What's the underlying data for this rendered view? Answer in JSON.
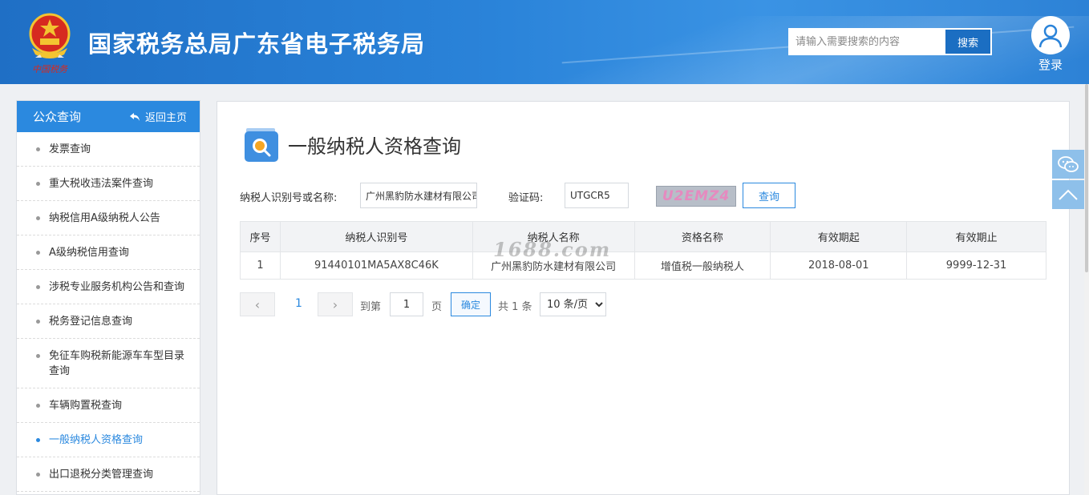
{
  "header": {
    "emblem_text": "中国税务",
    "site_title": "国家税务总局广东省电子税务局",
    "search_placeholder": "请输入需要搜索的内容",
    "search_button": "搜索",
    "login_label": "登录"
  },
  "sidebar": {
    "title": "公众查询",
    "back_home": "返回主页",
    "items": [
      {
        "label": "发票查询"
      },
      {
        "label": "重大税收违法案件查询"
      },
      {
        "label": "纳税信用A级纳税人公告"
      },
      {
        "label": "A级纳税信用查询"
      },
      {
        "label": "涉税专业服务机构公告和查询"
      },
      {
        "label": "税务登记信息查询"
      },
      {
        "label": "免征车购税新能源车车型目录查询"
      },
      {
        "label": "车辆购置税查询"
      },
      {
        "label": "一般纳税人资格查询"
      },
      {
        "label": "出口退税分类管理查询"
      }
    ],
    "active_index": 8
  },
  "main": {
    "title": "一般纳税人资格查询",
    "form": {
      "taxpayer_label": "纳税人识别号或名称:",
      "taxpayer_value": "广州黑豹防水建材有限公司",
      "captcha_label": "验证码:",
      "captcha_value": "UTGCR5",
      "captcha_image_text": "U2EMZ4",
      "query_button": "查询"
    },
    "table": {
      "columns": [
        "序号",
        "纳税人识别号",
        "纳税人名称",
        "资格名称",
        "有效期起",
        "有效期止"
      ],
      "rows": [
        [
          "1",
          "91440101MA5AX8C46K",
          "广州黑豹防水建材有限公司",
          "增值税一般纳税人",
          "2018-08-01",
          "9999-12-31"
        ]
      ]
    },
    "pager": {
      "prev": "‹",
      "current_page": "1",
      "next": "›",
      "goto_label": "到第",
      "goto_value": "1",
      "page_unit": "页",
      "confirm": "确定",
      "total": "共 1 条",
      "page_size": "10 条/页"
    },
    "watermark": "1688.com"
  },
  "floating_tools": {
    "wechat_icon": "wechat-icon",
    "back_to_top_icon": "chevron-up-icon"
  },
  "colors": {
    "header_blue": "#2a83d9",
    "accent": "#2b89df"
  }
}
